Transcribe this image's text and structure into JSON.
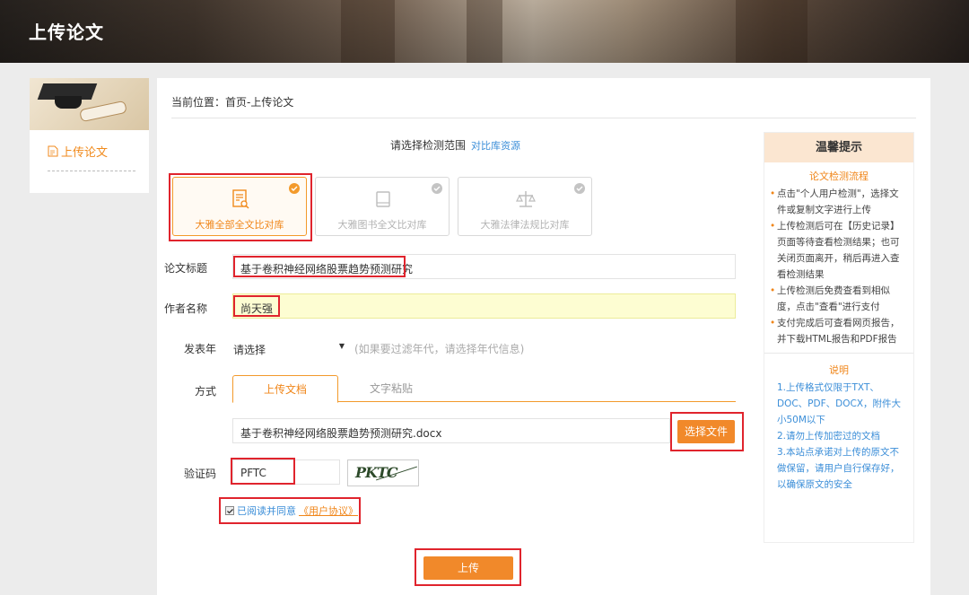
{
  "header": {
    "title": "上传论文"
  },
  "sidebar": {
    "item_label": "上传论文"
  },
  "main": {
    "breadcrumb": "当前位置：首页-上传论文",
    "scope_label": "请选择检测范围",
    "scope_link": "对比库资源",
    "databases": [
      {
        "label": "大雅全部全文比对库",
        "selected": true
      },
      {
        "label": "大雅图书全文比对库",
        "selected": false
      },
      {
        "label": "大雅法律法规比对库",
        "selected": false
      }
    ],
    "form": {
      "title_label": "论文标题",
      "title_value": "基于卷积神经网络股票趋势预测研究",
      "author_label": "作者名称",
      "author_value": "尚天强",
      "year_label": "发表年",
      "year_value": "请选择",
      "year_hint": "(如果要过滤年代，请选择年代信息)",
      "mode_label": "方式",
      "tab_upload": "上传文档",
      "tab_paste": "文字粘贴",
      "file_value": "基于卷积神经网络股票趋势预测研究.docx",
      "choose_file": "选择文件",
      "captcha_label": "验证码",
      "captcha_value": "PFTC",
      "captcha_image_text": "PKTC",
      "agree_text": "已阅读并同意",
      "agree_link": "《用户协议》",
      "upload_button": "上传"
    }
  },
  "tips": {
    "title": "温馨提示",
    "process_title": "论文检测流程",
    "items": [
      "点击\"个人用户检测\"，选择文件或复制文字进行上传",
      "上传检测后可在【历史记录】页面等待查看检测结果；也可关闭页面离开，稍后再进入查看检测结果",
      "上传检测后免费查看到相似度，点击\"查看\"进行支付",
      "支付完成后可查看网页报告，并下载HTML报告和PDF报告"
    ],
    "notes_title": "说明",
    "notes": [
      "1.上传格式仅限于TXT、DOC、PDF、DOCX，附件大小50M以下",
      "2.请勿上传加密过的文档",
      "3.本站点承诺对上传的原文不做保留，请用户自行保存好，以确保原文的安全"
    ]
  },
  "colors": {
    "accent": "#f1892a",
    "link": "#3b8ed8",
    "highlight": "#e0242d"
  }
}
